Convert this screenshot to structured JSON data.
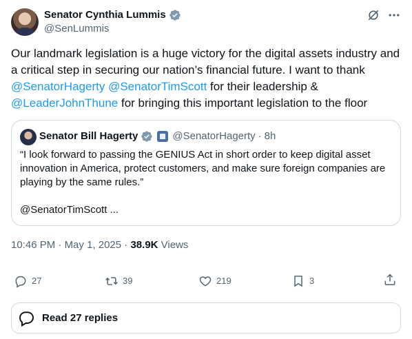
{
  "author": {
    "display_name": "Senator Cynthia Lummis",
    "handle": "@SenLummis"
  },
  "tweet": {
    "text_1": "Our landmark legislation is a huge victory for the digital assets industry and a critical step in securing our nation’s financial future. I want to thank ",
    "mention_1": "@SenatorHagerty",
    "text_2": " ",
    "mention_2": "@SenatorTimScott",
    "text_3": " for their leadership & ",
    "mention_3": "@LeaderJohnThune",
    "text_4": " for bringing this important legislation to the floor"
  },
  "quote": {
    "display_name": "Senator Bill Hagerty",
    "handle": "@SenatorHagerty",
    "separator": "·",
    "time": "8h",
    "text": "“I look forward to passing the GENIUS Act in short order to keep digital asset innovation in America, protect customers, and make sure foreign companies are playing by the same rules.”",
    "more": "@SenatorTimScott ..."
  },
  "meta": {
    "time": "10:46 PM",
    "sep1": " · ",
    "date": "May 1, 2025",
    "sep2": " · ",
    "views_count": "38.9K",
    "views_label": " Views"
  },
  "actions": {
    "replies": "27",
    "reposts": "39",
    "likes": "219",
    "bookmarks": "3"
  },
  "read_replies": {
    "label": "Read 27 replies"
  },
  "colors": {
    "link": "#1d9bf0",
    "verified": "#829aab",
    "secondary_text": "#536471",
    "border": "#cfd9de"
  },
  "icons": [
    "verified-badge-icon",
    "grok-icon",
    "more-icon",
    "government-badge-icon",
    "reply-icon",
    "retweet-icon",
    "like-icon",
    "bookmark-icon",
    "share-icon",
    "replies-bubble-icon"
  ]
}
